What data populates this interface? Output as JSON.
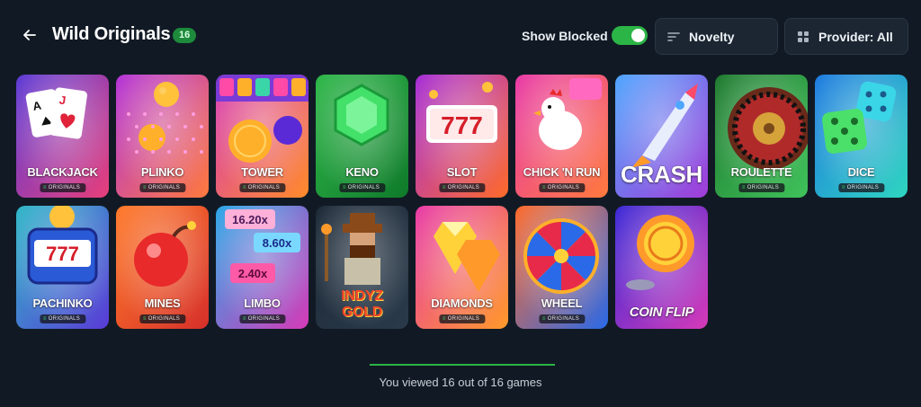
{
  "header": {
    "title": "Wild Originals",
    "count": "16",
    "show_blocked_label": "Show Blocked",
    "show_blocked_on": true,
    "sort_label": "Novelty",
    "provider_label": "Provider: All"
  },
  "badge_text": "ORIGINALS",
  "games": [
    {
      "name": "BLACKJACK",
      "theme": [
        "#5c3bd6",
        "#e83f7a"
      ]
    },
    {
      "name": "PLINKO",
      "theme": [
        "#b233d9",
        "#ff7a3d"
      ]
    },
    {
      "name": "TOWER",
      "theme": [
        "#d63ab8",
        "#ff8c2a"
      ]
    },
    {
      "name": "KENO",
      "theme": [
        "#2fb84a",
        "#0f7a2a"
      ]
    },
    {
      "name": "SLOT",
      "theme": [
        "#a52dd8",
        "#ff6b2a"
      ]
    },
    {
      "name": "CHICK 'N RUN",
      "theme": [
        "#e83aa8",
        "#ff7a3d"
      ]
    },
    {
      "name": "CRASH",
      "theme": [
        "#4ea6ff",
        "#a23bd8"
      ]
    },
    {
      "name": "ROULETTE",
      "theme": [
        "#1f7a2f",
        "#3fc25a"
      ]
    },
    {
      "name": "DICE",
      "theme": [
        "#1e7ae0",
        "#2fd6c0"
      ]
    },
    {
      "name": "PACHINKO",
      "theme": [
        "#2fb8c8",
        "#5a3bd6"
      ]
    },
    {
      "name": "MINES",
      "theme": [
        "#ff7a2a",
        "#d6302a"
      ]
    },
    {
      "name": "LIMBO",
      "theme": [
        "#2aa8e8",
        "#d63ab8"
      ]
    },
    {
      "name": "INDYZ GOLD",
      "theme": [
        "#1d2a38",
        "#2a3a4a"
      ]
    },
    {
      "name": "DIAMONDS",
      "theme": [
        "#e83aa8",
        "#ff9a2a"
      ]
    },
    {
      "name": "WHEEL",
      "theme": [
        "#ff6a2a",
        "#2a6ae8"
      ]
    },
    {
      "name": "COIN FLIP",
      "theme": [
        "#3b2ad6",
        "#d63ab8"
      ]
    }
  ],
  "limbo_multipliers": [
    "16.20x",
    "8.60x",
    "2.40x"
  ],
  "slot_digits": "777",
  "footer": {
    "viewed_text": "You viewed 16 out of 16 games",
    "viewed_fraction": 1.0
  }
}
